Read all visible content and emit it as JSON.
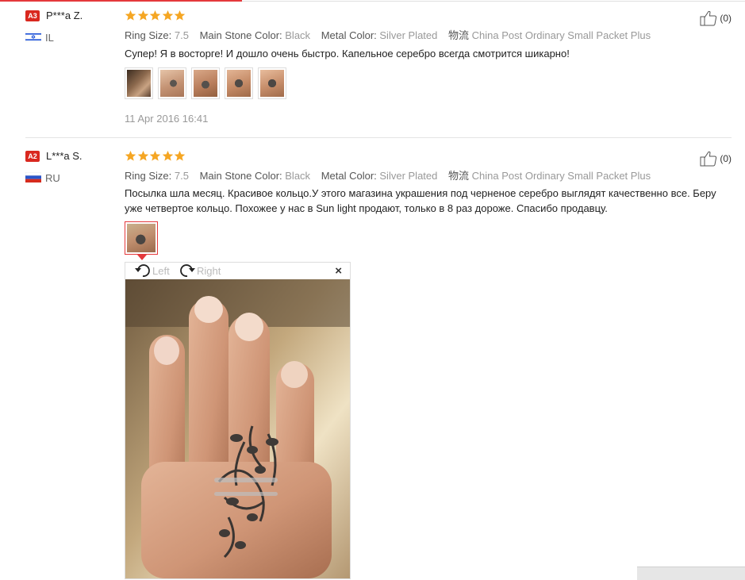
{
  "reviews": [
    {
      "badge": "A3",
      "user": "P***a Z.",
      "country": "IL",
      "rating": 5,
      "specs": [
        {
          "key": "Ring Size:",
          "value": "7.5"
        },
        {
          "key": "Main Stone Color:",
          "value": "Black"
        },
        {
          "key": "Metal Color:",
          "value": "Silver Plated"
        },
        {
          "key": "物流",
          "value": "China Post Ordinary Small Packet Plus"
        }
      ],
      "comment": "Супер! Я в восторге! И дошло очень быстро. Капельное серебро всегда смотрится шикарно!",
      "photo_count": 5,
      "date": "11 Apr 2016 16:41",
      "likes": "(0)"
    },
    {
      "badge": "A2",
      "user": "L***a S.",
      "country": "RU",
      "rating": 5,
      "specs": [
        {
          "key": "Ring Size:",
          "value": "7.5"
        },
        {
          "key": "Main Stone Color:",
          "value": "Black"
        },
        {
          "key": "Metal Color:",
          "value": "Silver Plated"
        },
        {
          "key": "物流",
          "value": "China Post Ordinary Small Packet Plus"
        }
      ],
      "comment": "Посылка шла месяц. Красивое кольцо.У этого магазина украшения под черненое серебро выглядят качественно все. Беру уже четвертое кольцо. Похожее у нас в Sun light продают, только в 8 раз дороже. Спасибо продавцу.",
      "photo_count": 1,
      "likes": "(0)"
    }
  ],
  "viewer": {
    "rotate_left": "Left",
    "rotate_right": "Right",
    "close": "×"
  },
  "colors": {
    "accent": "#e4393c",
    "star": "#f5a623",
    "badge": "#d9281f"
  }
}
